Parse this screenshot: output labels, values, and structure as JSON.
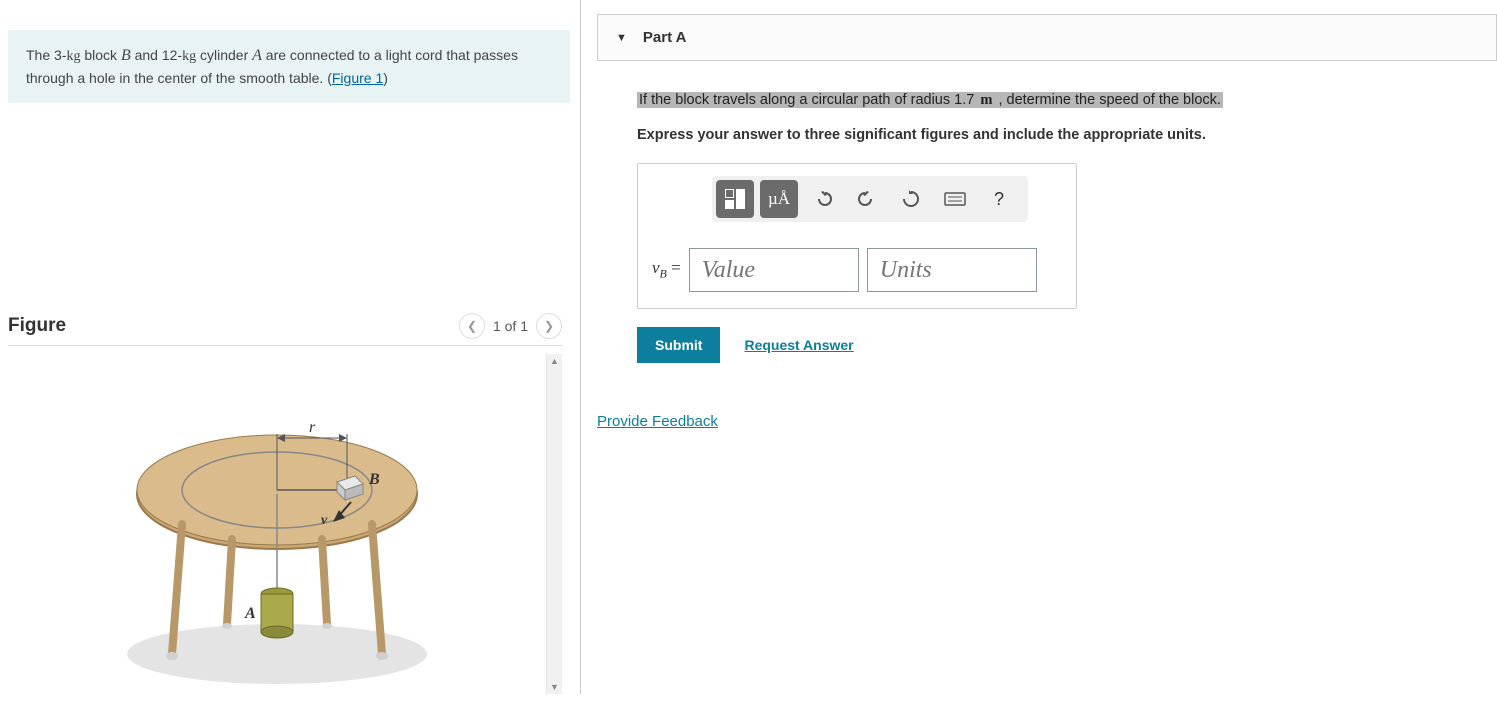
{
  "problem": {
    "text_before_b": "The 3-",
    "kg1": "kg",
    "text_block": " block ",
    "B": "B",
    "text_and": " and 12-",
    "kg2": "kg",
    "text_cyl": " cylinder ",
    "A": "A",
    "text_rest": " are connected to a light cord that passes through a hole in the center of the smooth table. (",
    "figure_link": "Figure 1",
    "close": ")"
  },
  "figure": {
    "title": "Figure",
    "counter": "1 of 1",
    "labels": {
      "r": "r",
      "B": "B",
      "v": "v",
      "A": "A"
    }
  },
  "partA": {
    "title": "Part A",
    "prompt_pre": "If the block travels along a circular path of radius 1.7 ",
    "prompt_unit": "m",
    "prompt_post": " , determine the speed of the block.",
    "instruction": "Express your answer to three significant figures and include the appropriate units.",
    "toolbar": {
      "units_btn": "µÅ",
      "help": "?"
    },
    "label_v": "v",
    "label_sub": "B",
    "label_eq": " =",
    "value_placeholder": "Value",
    "units_placeholder": "Units",
    "submit": "Submit",
    "request": "Request Answer"
  },
  "feedback": "Provide Feedback"
}
